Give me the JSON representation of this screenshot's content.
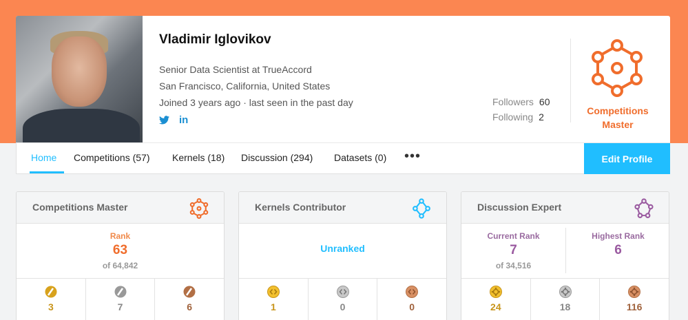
{
  "profile": {
    "name": "Vladimir Iglovikov",
    "title": "Senior Data Scientist at TrueAccord",
    "location": "San Francisco, California, United States",
    "joined": "Joined 3 years ago · last seen in the past day",
    "social": {
      "twitter_icon": "twitter-icon",
      "linkedin_label": "in"
    },
    "followers_label": "Followers",
    "followers_count": "60",
    "following_label": "Following",
    "following_count": "2",
    "tier": "Competitions Master",
    "tier_line1": "Competitions",
    "tier_line2": "Master"
  },
  "nav": {
    "tabs": [
      {
        "label": "Home",
        "active": true
      },
      {
        "label": "Competitions (57)"
      },
      {
        "label": "Kernels (18)"
      },
      {
        "label": "Discussion (294)"
      },
      {
        "label": "Datasets (0)"
      }
    ],
    "more": "•••",
    "edit_profile": "Edit Profile"
  },
  "panels": [
    {
      "title": "Competitions Master",
      "icon": "competitions-master-icon",
      "rank_label": "Rank",
      "rank": "63",
      "rank_of": "of 64,842",
      "medals": [
        {
          "type": "gold",
          "count": "3"
        },
        {
          "type": "silver",
          "count": "7"
        },
        {
          "type": "bronze",
          "count": "6"
        }
      ]
    },
    {
      "title": "Kernels Contributor",
      "icon": "kernels-contributor-icon",
      "status": "Unranked",
      "medals": [
        {
          "type": "gold",
          "count": "1"
        },
        {
          "type": "silver",
          "count": "0"
        },
        {
          "type": "bronze",
          "count": "0"
        }
      ]
    },
    {
      "title": "Discussion Expert",
      "icon": "discussion-expert-icon",
      "current_rank_label": "Current Rank",
      "current_rank": "7",
      "current_rank_of": "of 34,516",
      "highest_rank_label": "Highest Rank",
      "highest_rank": "6",
      "medals": [
        {
          "type": "gold",
          "count": "24"
        },
        {
          "type": "silver",
          "count": "18"
        },
        {
          "type": "bronze",
          "count": "116"
        }
      ]
    }
  ],
  "colors": {
    "banner": "#fb8651",
    "accent_blue": "#20beff",
    "competitions_orange": "#f06d2c",
    "discussion_purple": "#9a5aa0",
    "gold": "#d8a21d",
    "silver": "#999999",
    "bronze": "#b26f45"
  }
}
